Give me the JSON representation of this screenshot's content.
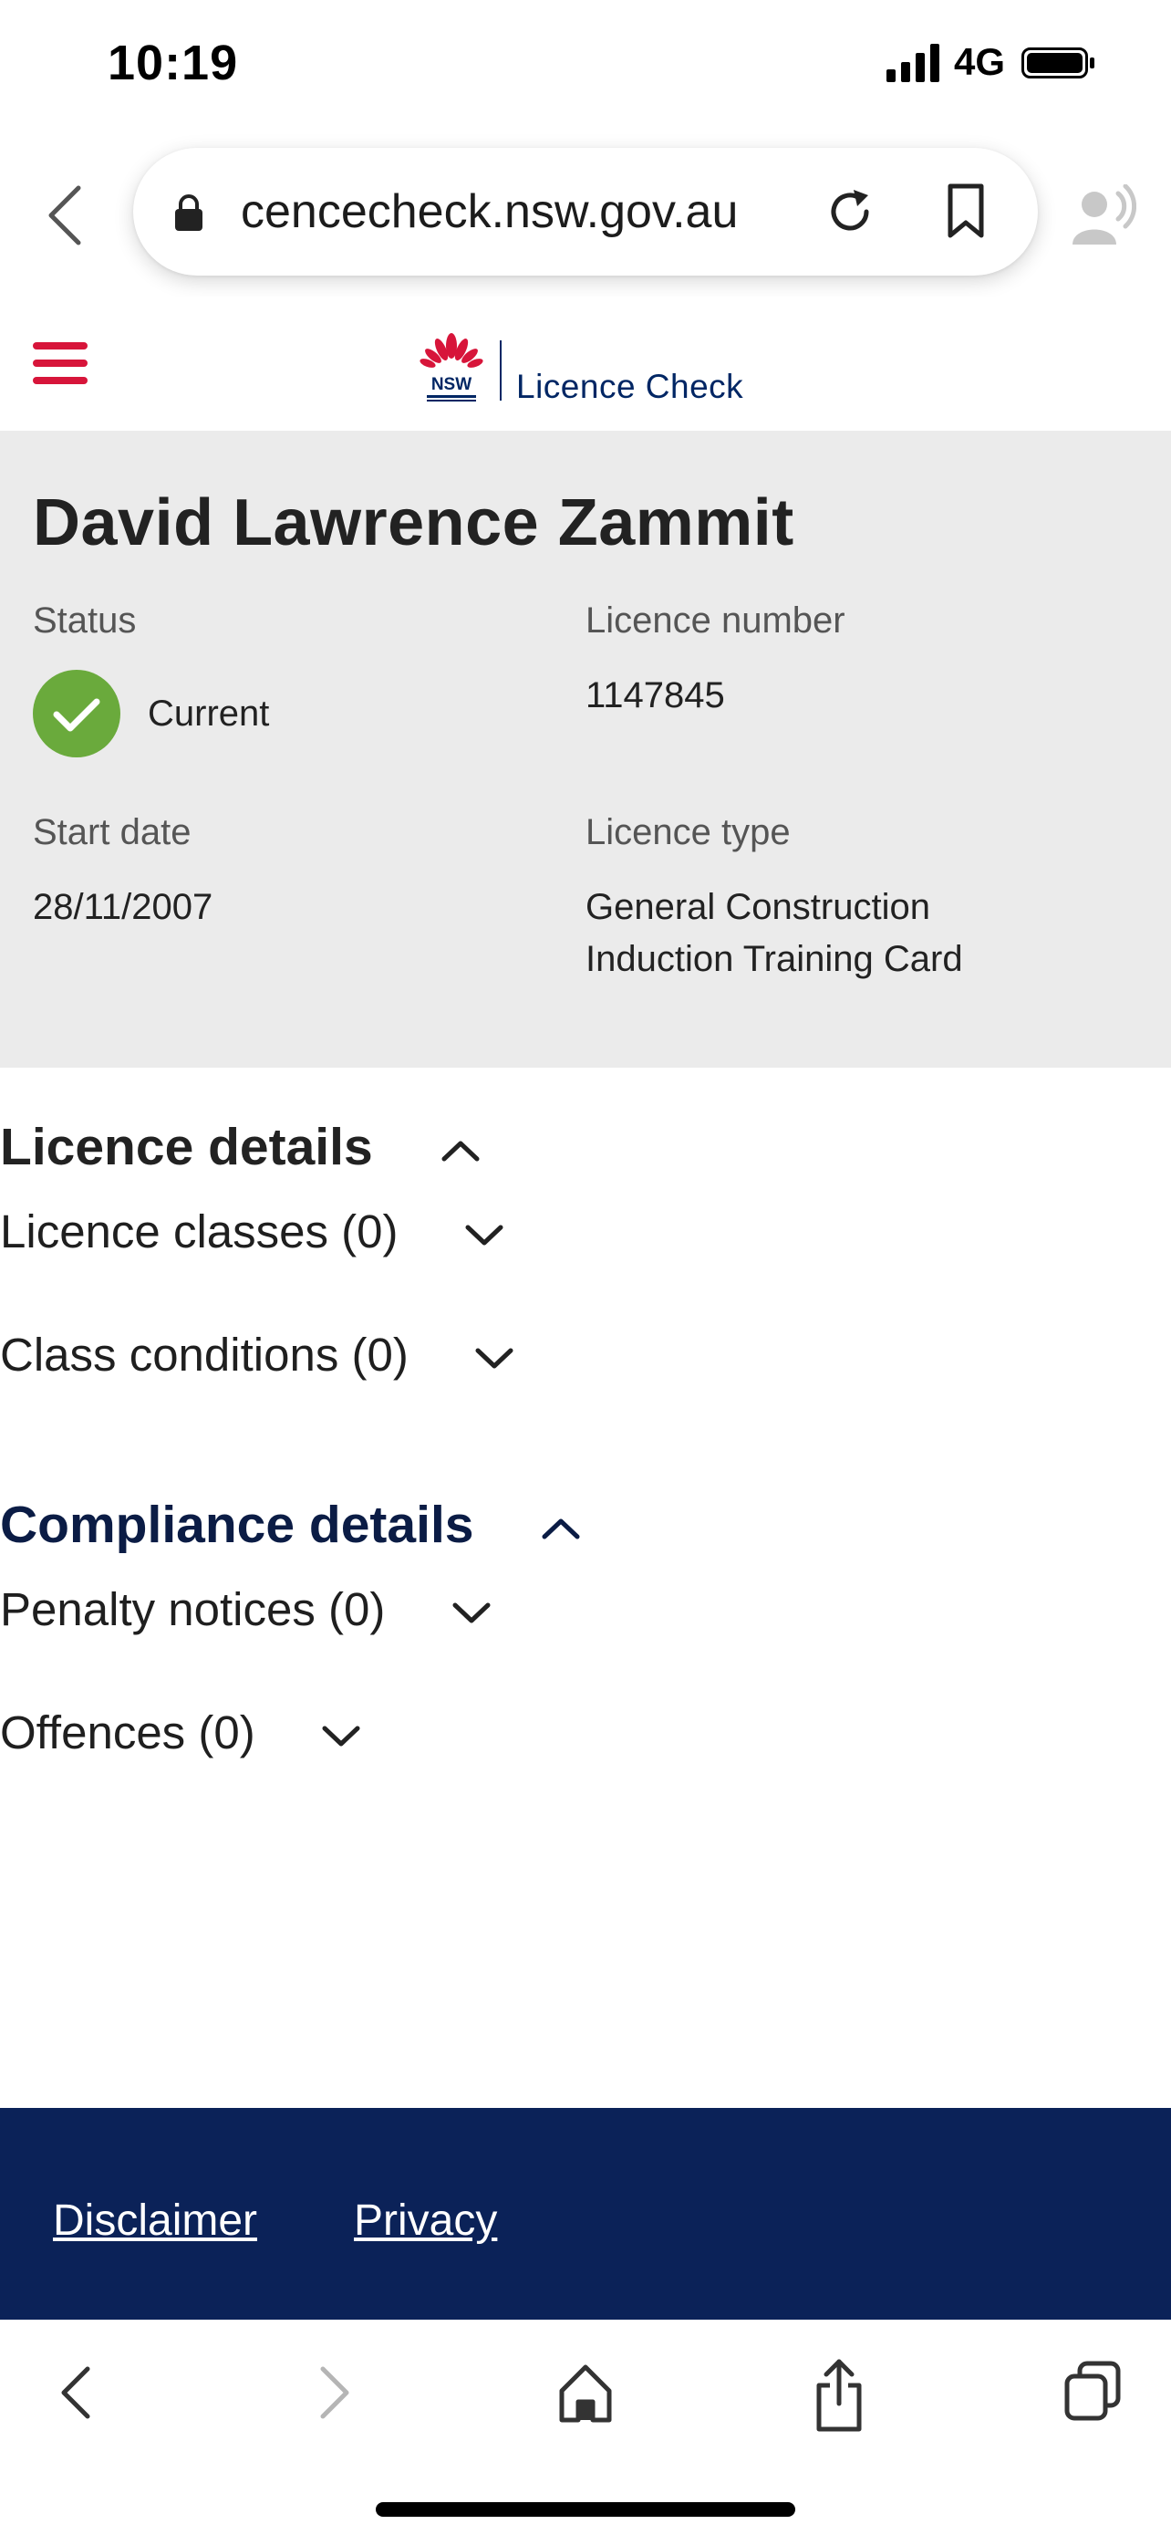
{
  "status_bar": {
    "time": "10:19",
    "network": "4G"
  },
  "browser": {
    "url": "cencecheck.nsw.gov.au"
  },
  "site": {
    "logo_text": "NSW",
    "title": "Licence Check"
  },
  "licence": {
    "holder_name": "David Lawrence Zammit",
    "status_label": "Status",
    "status_value": "Current",
    "number_label": "Licence number",
    "number_value": "1147845",
    "start_label": "Start date",
    "start_value": "28/11/2007",
    "type_label": "Licence type",
    "type_line1": "General Construction",
    "type_line2": "Induction Training Card"
  },
  "licence_details": {
    "heading": "Licence details",
    "classes_label": "Licence classes (0)",
    "conditions_label": "Class conditions (0)"
  },
  "compliance_details": {
    "heading": "Compliance details",
    "penalty_label": "Penalty notices (0)",
    "offences_label": "Offences (0)"
  },
  "footer": {
    "disclaimer": "Disclaimer",
    "privacy": "Privacy"
  },
  "colors": {
    "nsw_navy": "#0b2258",
    "nsw_red": "#d7153a",
    "status_green": "#6aaa3c"
  }
}
